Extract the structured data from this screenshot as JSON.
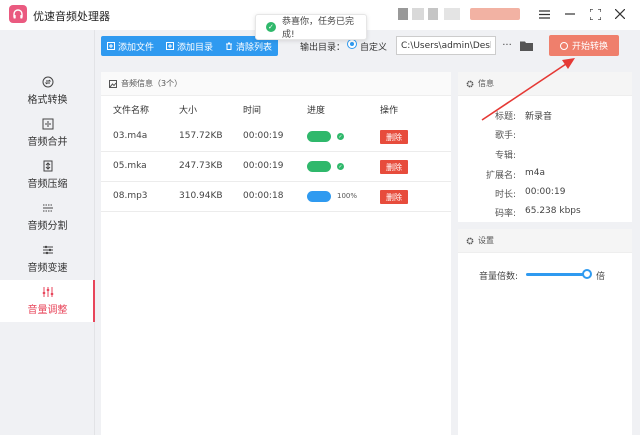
{
  "app": {
    "title": "优速音频处理器"
  },
  "toast": {
    "text": "恭喜你，任务已完成!"
  },
  "sidebar": {
    "items": [
      {
        "label": "格式转换",
        "icon": "format-convert-icon"
      },
      {
        "label": "音频合并",
        "icon": "merge-icon"
      },
      {
        "label": "音频压缩",
        "icon": "compress-icon"
      },
      {
        "label": "音频分割",
        "icon": "split-icon"
      },
      {
        "label": "音频变速",
        "icon": "speed-icon"
      },
      {
        "label": "音量调整",
        "icon": "volume-adjust-icon",
        "active": true
      }
    ]
  },
  "toolbar": {
    "add_file": "添加文件",
    "add_folder": "添加目录",
    "clear_list": "清除列表"
  },
  "output": {
    "label": "输出目录：",
    "option": "自定义",
    "path": "C:\\Users\\admin\\Deskto",
    "more": "···"
  },
  "start_button": "开始转换",
  "list": {
    "title": "音频信息（3个）",
    "columns": [
      "文件名称",
      "大小",
      "时间",
      "进度",
      "操作"
    ],
    "rows": [
      {
        "name": "03.m4a",
        "size": "157.72KB",
        "time": "00:00:19",
        "progress_status": "done",
        "delete": "删除"
      },
      {
        "name": "05.mka",
        "size": "247.73KB",
        "time": "00:00:19",
        "progress_status": "done",
        "delete": "删除"
      },
      {
        "name": "08.mp3",
        "size": "310.94KB",
        "time": "00:00:18",
        "progress_status": "percent",
        "progress_text": "100%",
        "delete": "删除"
      }
    ]
  },
  "info": {
    "title": "信息",
    "fields": [
      {
        "label": "标题:",
        "value": "新录音"
      },
      {
        "label": "歌手:",
        "value": ""
      },
      {
        "label": "专辑:",
        "value": ""
      },
      {
        "label": "扩展名:",
        "value": "m4a"
      },
      {
        "label": "时长:",
        "value": "00:00:19"
      },
      {
        "label": "码率:",
        "value": "65.238 kbps"
      }
    ]
  },
  "settings": {
    "title": "设置",
    "volume_label": "音量倍数:",
    "volume_unit": "倍"
  },
  "colors": {
    "accent_blue": "#2f9af0",
    "active_red": "#e8465b",
    "start_orange": "#ef7f6c",
    "delete_red": "#e74c3c",
    "progress_green": "#2fb86b"
  }
}
